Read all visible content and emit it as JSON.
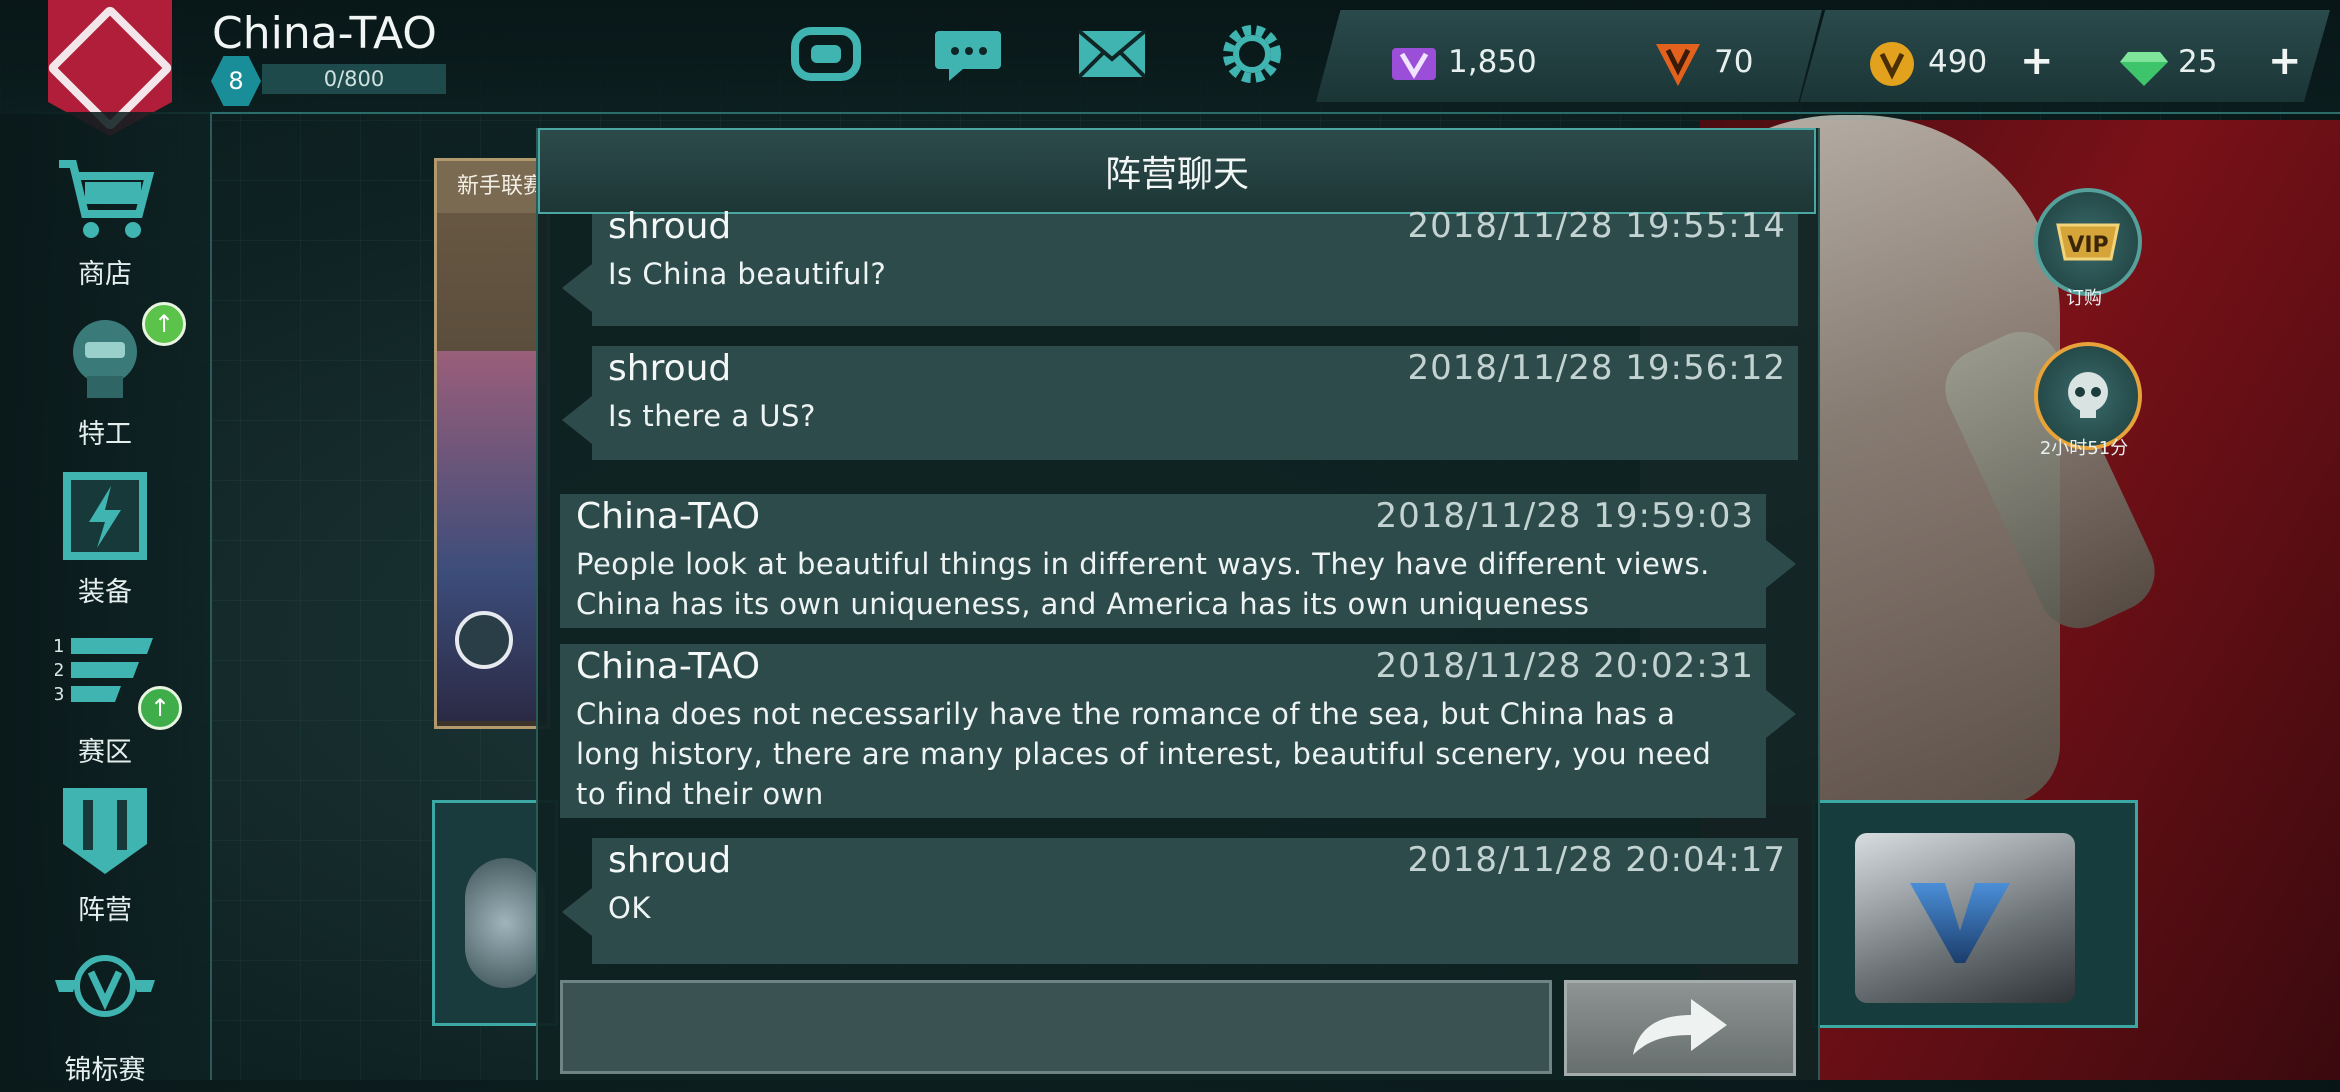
{
  "player": {
    "name": "China-TAO",
    "level": "8",
    "xp": "0/800"
  },
  "currencies": [
    {
      "name": "purple-v-points",
      "value": "1,850",
      "color": "#9b4fd8"
    },
    {
      "name": "orange-v-points",
      "value": "70",
      "color": "#e2621d"
    },
    {
      "name": "gold-credits",
      "value": "490",
      "color": "#e2a21d",
      "plus": "+"
    },
    {
      "name": "diamonds",
      "value": "25",
      "color": "#3ec46a",
      "plus": "+"
    }
  ],
  "sidebar": {
    "items": [
      {
        "label": "商店",
        "icon": "cart-icon"
      },
      {
        "label": "特工",
        "icon": "agent-helmet-icon"
      },
      {
        "label": "装备",
        "icon": "equipment-icon"
      },
      {
        "label": "赛区",
        "icon": "ranking-icon"
      },
      {
        "label": "阵营",
        "icon": "faction-banner-icon"
      },
      {
        "label": "锦标赛",
        "icon": "tournament-icon"
      }
    ]
  },
  "background": {
    "event_tab": "新手联赛",
    "vip_label": "订购",
    "timer_label": "2小时51分"
  },
  "chat": {
    "title": "阵营聊天",
    "messages": [
      {
        "sender": "shroud",
        "time": "2018/11/28 19:55:14",
        "text": "Is China beautiful?",
        "side": "other"
      },
      {
        "sender": "shroud",
        "time": "2018/11/28 19:56:12",
        "text": "Is there a US?",
        "side": "other"
      },
      {
        "sender": "China-TAO",
        "time": "2018/11/28 19:59:03",
        "text": "People look at beautiful things in different ways. They have different views. China has its own uniqueness, and America has its own uniqueness",
        "side": "self"
      },
      {
        "sender": "China-TAO",
        "time": "2018/11/28 20:02:31",
        "text": "China does not necessarily have the romance of the sea, but China has a long history, there are many places of interest, beautiful scenery, you need to find their own",
        "side": "self"
      },
      {
        "sender": "shroud",
        "time": "2018/11/28 20:04:17",
        "text": "OK",
        "side": "other"
      }
    ],
    "input_value": "",
    "send_icon": "share-arrow-icon"
  }
}
